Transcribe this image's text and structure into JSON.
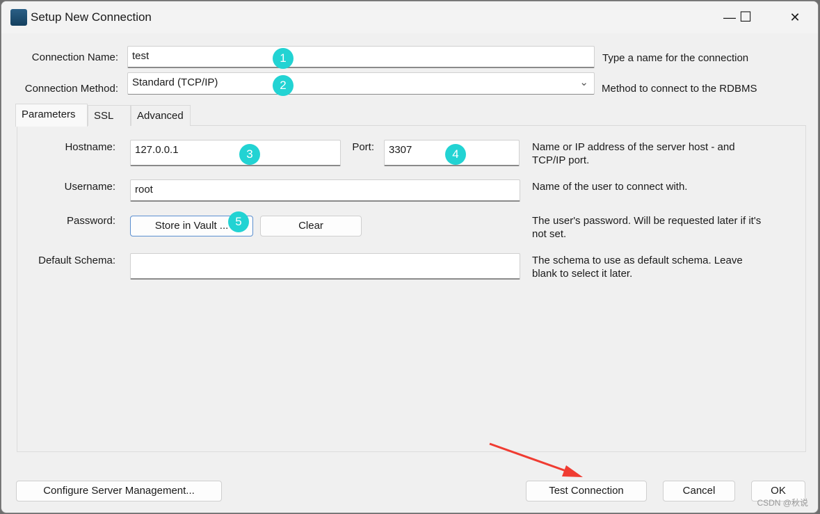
{
  "window": {
    "title": "Setup New Connection",
    "minimize": "—",
    "maximize": "☐",
    "close": "✕"
  },
  "form": {
    "connection_name_label": "Connection Name:",
    "connection_name": "test",
    "connection_name_hint": "Type a name for the connection",
    "connection_method_label": "Connection Method:",
    "connection_method": "Standard (TCP/IP)",
    "connection_method_hint": "Method to connect to the RDBMS"
  },
  "tabs": [
    {
      "label": "Parameters",
      "active": true
    },
    {
      "label": "SSL"
    },
    {
      "label": "Advanced"
    }
  ],
  "parameters": {
    "hostname_label": "Hostname:",
    "hostname": "127.0.0.1",
    "port_label": "Port:",
    "port": "3307",
    "host_hint_1": "Name or IP address of the server host - and",
    "host_hint_2": "TCP/IP port.",
    "username_label": "Username:",
    "username": "root",
    "username_hint": "Name of the user to connect with.",
    "password_label": "Password:",
    "store_vault": "Store in Vault ...",
    "clear": "Clear",
    "password_hint_1": "The user's password. Will be requested later if it's",
    "password_hint_2": "not set.",
    "schema_label": "Default Schema:",
    "schema": "",
    "schema_hint_1": "The schema to use as default schema. Leave",
    "schema_hint_2": "blank to select it later."
  },
  "buttons": {
    "configure": "Configure Server Management...",
    "test": "Test Connection",
    "cancel": "Cancel",
    "ok": "OK"
  },
  "annotations": {
    "badges": [
      "1",
      "2",
      "3",
      "4",
      "5"
    ],
    "badge_color": "#22d3d3",
    "arrow_color": "#f03c32"
  },
  "watermark": "CSDN @秋说"
}
